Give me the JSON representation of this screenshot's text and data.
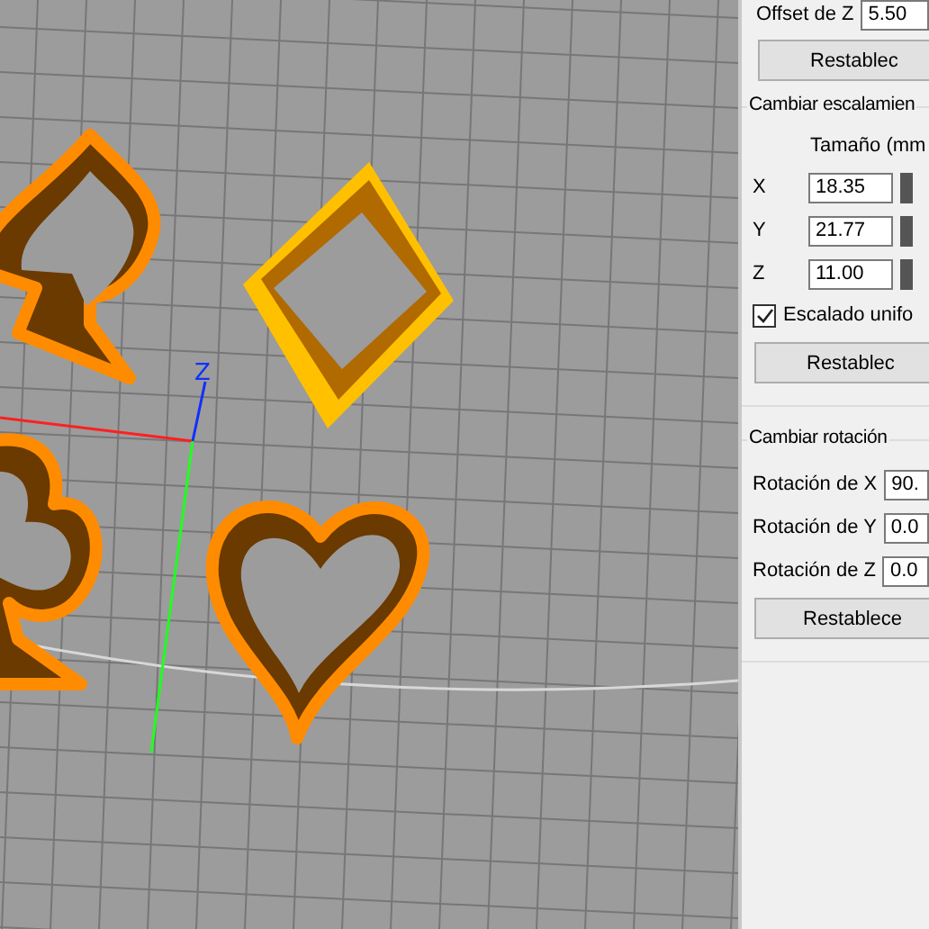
{
  "viewport": {
    "axis_label": "Z"
  },
  "offset": {
    "label": "Offset de Z",
    "value": "5.50",
    "button": "Restablec"
  },
  "scale": {
    "title": "Cambiar escalamien",
    "size_label": "Tamaño (mm",
    "rows": [
      {
        "axis": "X",
        "value": "18.35"
      },
      {
        "axis": "Y",
        "value": "21.77"
      },
      {
        "axis": "Z",
        "value": "11.00"
      }
    ],
    "uniform": {
      "label": "Escalado unifo",
      "checked": true
    },
    "button": "Restablec"
  },
  "rotation": {
    "title": "Cambiar rotación",
    "rows": [
      {
        "label": "Rotación de X",
        "value": "90."
      },
      {
        "label": "Rotación de Y",
        "value": "0.0"
      },
      {
        "label": "Rotación de Z",
        "value": "0.0"
      }
    ],
    "button": "Restablece"
  }
}
